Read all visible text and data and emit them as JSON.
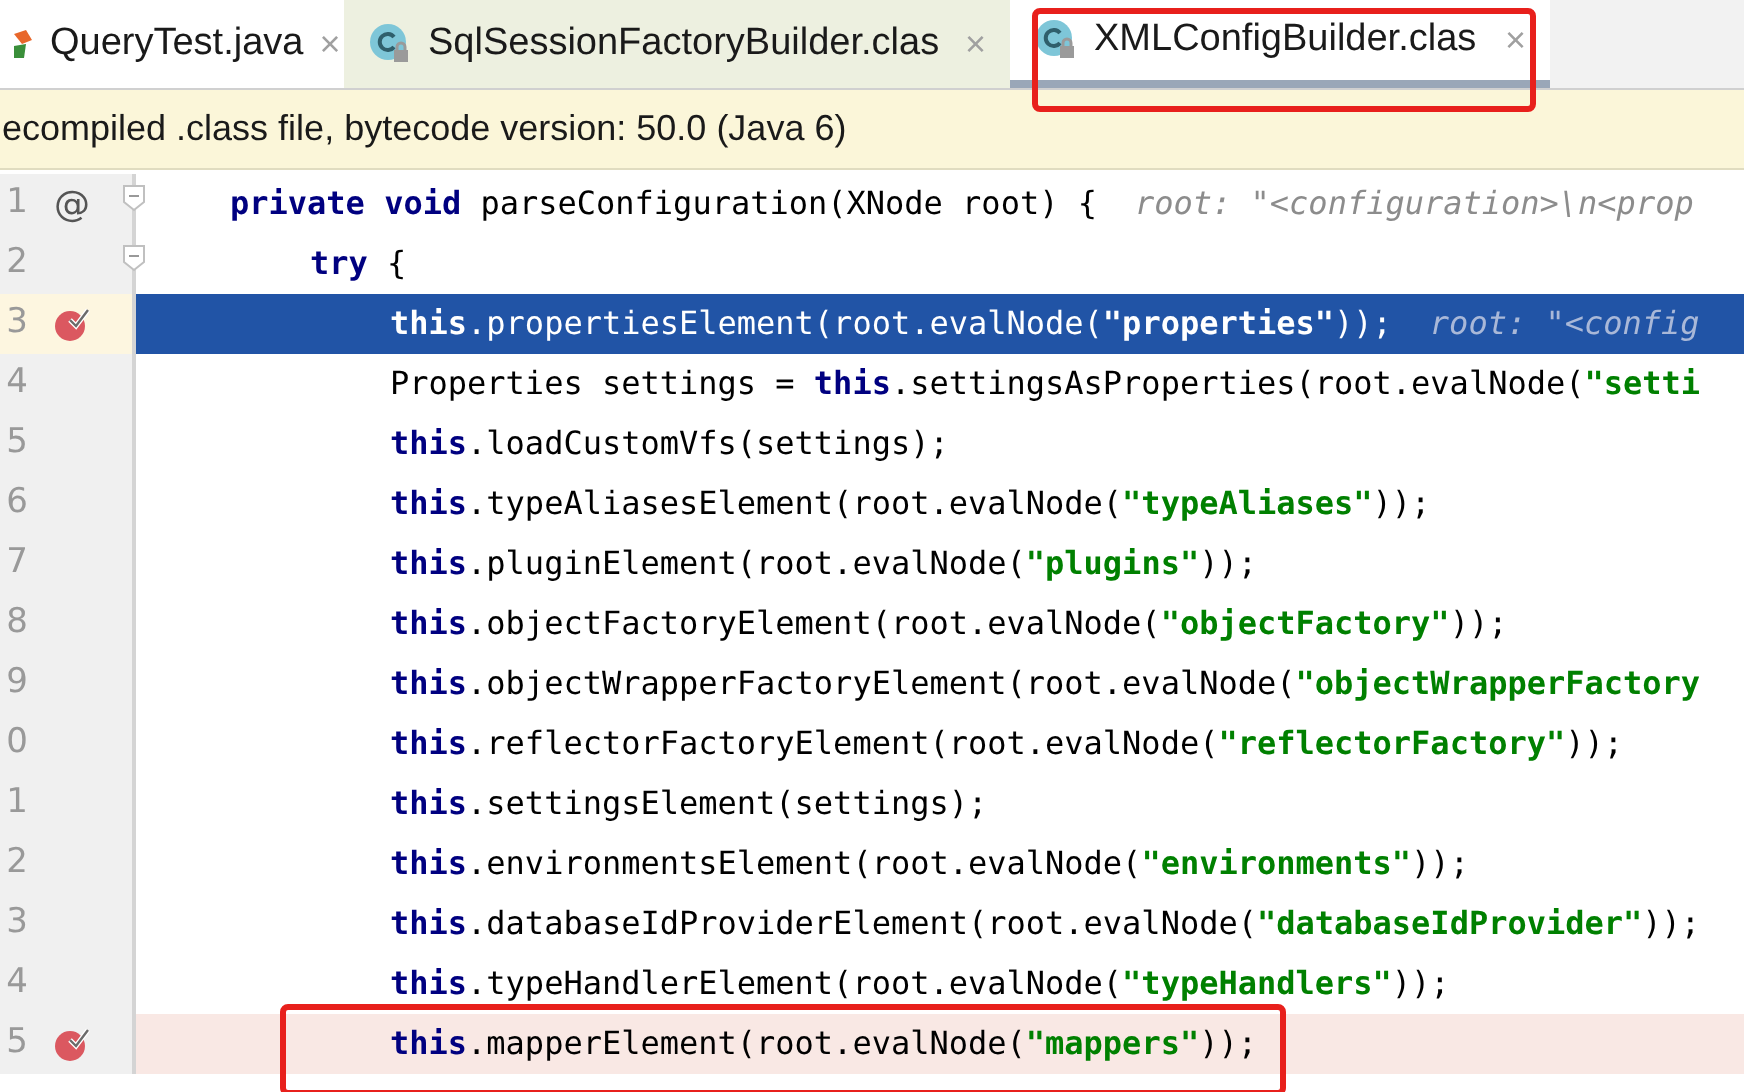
{
  "tabs": [
    {
      "label": "QueryTest.java",
      "close": "×",
      "kind": "java",
      "selected": false,
      "annotated": false
    },
    {
      "label": "SqlSessionFactoryBuilder.clas",
      "close": "×",
      "kind": "class",
      "selected": false,
      "annotated": false
    },
    {
      "label": "XMLConfigBuilder.clas",
      "close": "×",
      "kind": "class",
      "selected": true,
      "annotated": true
    }
  ],
  "banner": "ecompiled .class file, bytecode version: 50.0 (Java 6)",
  "lines": [
    {
      "number": "1",
      "gutter_mark": "@",
      "fold": true,
      "breakpoint": false,
      "current": false,
      "annotated": false,
      "tokens": [
        {
          "kind": "kw",
          "text": "private void"
        },
        {
          "kind": "plain",
          "text": " parseConfiguration(XNode root) {"
        },
        {
          "kind": "hint",
          "text": "root: \"<configuration>\\n<prop"
        }
      ],
      "children": [
        {
          "number": "2",
          "fold": true,
          "breakpoint": false,
          "current": false,
          "annotated": false,
          "tokens": [
            {
              "kind": "kw",
              "text": "try"
            },
            {
              "kind": "plain",
              "text": " {"
            }
          ],
          "children": [
            {
              "number": "3",
              "fold": false,
              "breakpoint": true,
              "current": true,
              "annotated": false,
              "tokens": [
                {
                  "kind": "kw",
                  "text": "this"
                },
                {
                  "kind": "plain",
                  "text": ".propertiesElement(root.evalNode("
                },
                {
                  "kind": "str",
                  "text": "\"properties\""
                },
                {
                  "kind": "plain",
                  "text": "));"
                },
                {
                  "kind": "hint",
                  "text": "root: \"<config"
                }
              ]
            },
            {
              "number": "4",
              "fold": false,
              "breakpoint": false,
              "current": false,
              "annotated": false,
              "tokens": [
                {
                  "kind": "plain",
                  "text": "Properties settings = "
                },
                {
                  "kind": "kw",
                  "text": "this"
                },
                {
                  "kind": "plain",
                  "text": ".settingsAsProperties(root.evalNode("
                },
                {
                  "kind": "str",
                  "text": "\"setti"
                }
              ]
            },
            {
              "number": "5",
              "fold": false,
              "breakpoint": false,
              "current": false,
              "annotated": false,
              "tokens": [
                {
                  "kind": "kw",
                  "text": "this"
                },
                {
                  "kind": "plain",
                  "text": ".loadCustomVfs(settings);"
                }
              ]
            },
            {
              "number": "6",
              "fold": false,
              "breakpoint": false,
              "current": false,
              "annotated": false,
              "tokens": [
                {
                  "kind": "kw",
                  "text": "this"
                },
                {
                  "kind": "plain",
                  "text": ".typeAliasesElement(root.evalNode("
                },
                {
                  "kind": "str",
                  "text": "\"typeAliases\""
                },
                {
                  "kind": "plain",
                  "text": "));"
                }
              ]
            },
            {
              "number": "7",
              "fold": false,
              "breakpoint": false,
              "current": false,
              "annotated": false,
              "tokens": [
                {
                  "kind": "kw",
                  "text": "this"
                },
                {
                  "kind": "plain",
                  "text": ".pluginElement(root.evalNode("
                },
                {
                  "kind": "str",
                  "text": "\"plugins\""
                },
                {
                  "kind": "plain",
                  "text": "));"
                }
              ]
            },
            {
              "number": "8",
              "fold": false,
              "breakpoint": false,
              "current": false,
              "annotated": false,
              "tokens": [
                {
                  "kind": "kw",
                  "text": "this"
                },
                {
                  "kind": "plain",
                  "text": ".objectFactoryElement(root.evalNode("
                },
                {
                  "kind": "str",
                  "text": "\"objectFactory\""
                },
                {
                  "kind": "plain",
                  "text": "));"
                }
              ]
            },
            {
              "number": "9",
              "fold": false,
              "breakpoint": false,
              "current": false,
              "annotated": false,
              "tokens": [
                {
                  "kind": "kw",
                  "text": "this"
                },
                {
                  "kind": "plain",
                  "text": ".objectWrapperFactoryElement(root.evalNode("
                },
                {
                  "kind": "str",
                  "text": "\"objectWrapperFactory"
                }
              ]
            },
            {
              "number": "0",
              "fold": false,
              "breakpoint": false,
              "current": false,
              "annotated": false,
              "tokens": [
                {
                  "kind": "kw",
                  "text": "this"
                },
                {
                  "kind": "plain",
                  "text": ".reflectorFactoryElement(root.evalNode("
                },
                {
                  "kind": "str",
                  "text": "\"reflectorFactory\""
                },
                {
                  "kind": "plain",
                  "text": "));"
                }
              ]
            },
            {
              "number": "1",
              "fold": false,
              "breakpoint": false,
              "current": false,
              "annotated": false,
              "tokens": [
                {
                  "kind": "kw",
                  "text": "this"
                },
                {
                  "kind": "plain",
                  "text": ".settingsElement(settings);"
                }
              ]
            },
            {
              "number": "2",
              "fold": false,
              "breakpoint": false,
              "current": false,
              "annotated": false,
              "tokens": [
                {
                  "kind": "kw",
                  "text": "this"
                },
                {
                  "kind": "plain",
                  "text": ".environmentsElement(root.evalNode("
                },
                {
                  "kind": "str",
                  "text": "\"environments\""
                },
                {
                  "kind": "plain",
                  "text": "));"
                }
              ]
            },
            {
              "number": "3",
              "fold": false,
              "breakpoint": false,
              "current": false,
              "annotated": false,
              "tokens": [
                {
                  "kind": "kw",
                  "text": "this"
                },
                {
                  "kind": "plain",
                  "text": ".databaseIdProviderElement(root.evalNode("
                },
                {
                  "kind": "str",
                  "text": "\"databaseIdProvider\""
                },
                {
                  "kind": "plain",
                  "text": "));"
                }
              ]
            },
            {
              "number": "4",
              "fold": false,
              "breakpoint": false,
              "current": false,
              "annotated": false,
              "tokens": [
                {
                  "kind": "kw",
                  "text": "this"
                },
                {
                  "kind": "plain",
                  "text": ".typeHandlerElement(root.evalNode("
                },
                {
                  "kind": "str",
                  "text": "\"typeHandlers\""
                },
                {
                  "kind": "plain",
                  "text": "));"
                }
              ]
            },
            {
              "number": "5",
              "fold": false,
              "breakpoint": true,
              "current": false,
              "annotated": true,
              "tokens": [
                {
                  "kind": "kw",
                  "text": "this"
                },
                {
                  "kind": "plain",
                  "text": ".mapperElement(root.evalNode("
                },
                {
                  "kind": "str",
                  "text": "\"mappers\""
                },
                {
                  "kind": "plain",
                  "text": "));"
                }
              ]
            }
          ]
        }
      ]
    }
  ]
}
